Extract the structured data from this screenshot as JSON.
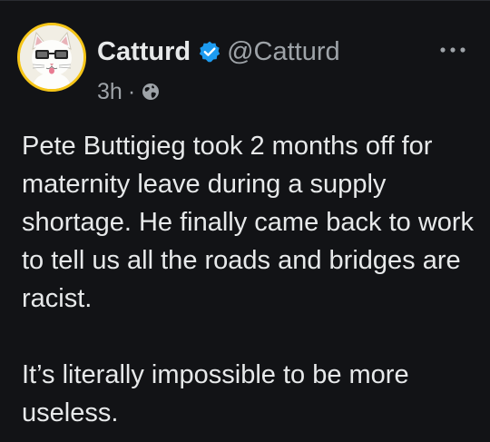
{
  "tweet": {
    "author": {
      "display_name": "Catturd",
      "handle": "@Catturd",
      "verified": true,
      "avatar": "cat-with-glasses-avatar"
    },
    "meta": {
      "time": "3h",
      "separator": "·",
      "visibility_icon": "globe-icon"
    },
    "body": {
      "paragraph_1": "Pete Buttigieg took 2 months off for maternity leave during a supply shortage. He finally came back to work to tell us all the roads and bridges are racist.",
      "paragraph_2": "It’s literally impossible to be more useless."
    }
  },
  "colors": {
    "background": "#121316",
    "text": "#e7e9ea",
    "secondary_text": "#9ea3a8",
    "verified_badge": "#1d9bf0",
    "avatar_ring": "#f5c518"
  }
}
